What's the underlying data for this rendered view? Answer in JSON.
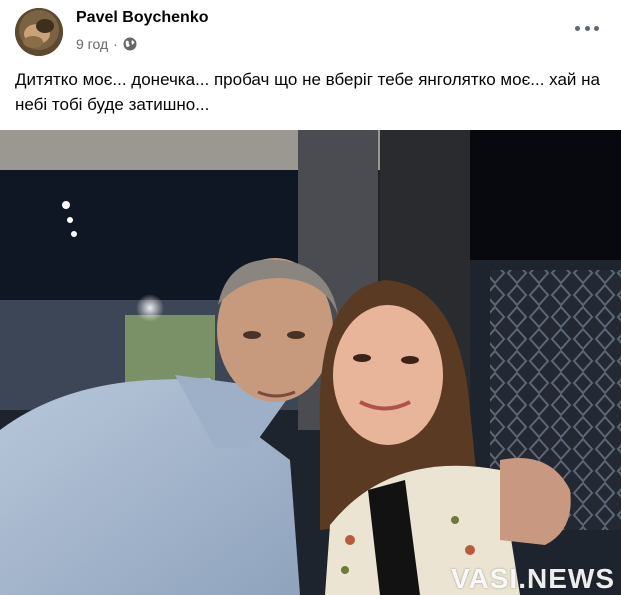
{
  "post": {
    "author": "Pavel Boychenko",
    "time": "9 год",
    "separator": "·",
    "privacy_icon": "globe-icon",
    "more_icon": "more-options-icon",
    "text": "Дитятко моє... донечка... пробач що не вберіг тебе янголятко моє... хай на небі тобі буде затишно..."
  },
  "photo": {
    "watermark": "VASI.NEWS"
  },
  "colors": {
    "author_text": "#050505",
    "meta_text": "#65676b"
  }
}
